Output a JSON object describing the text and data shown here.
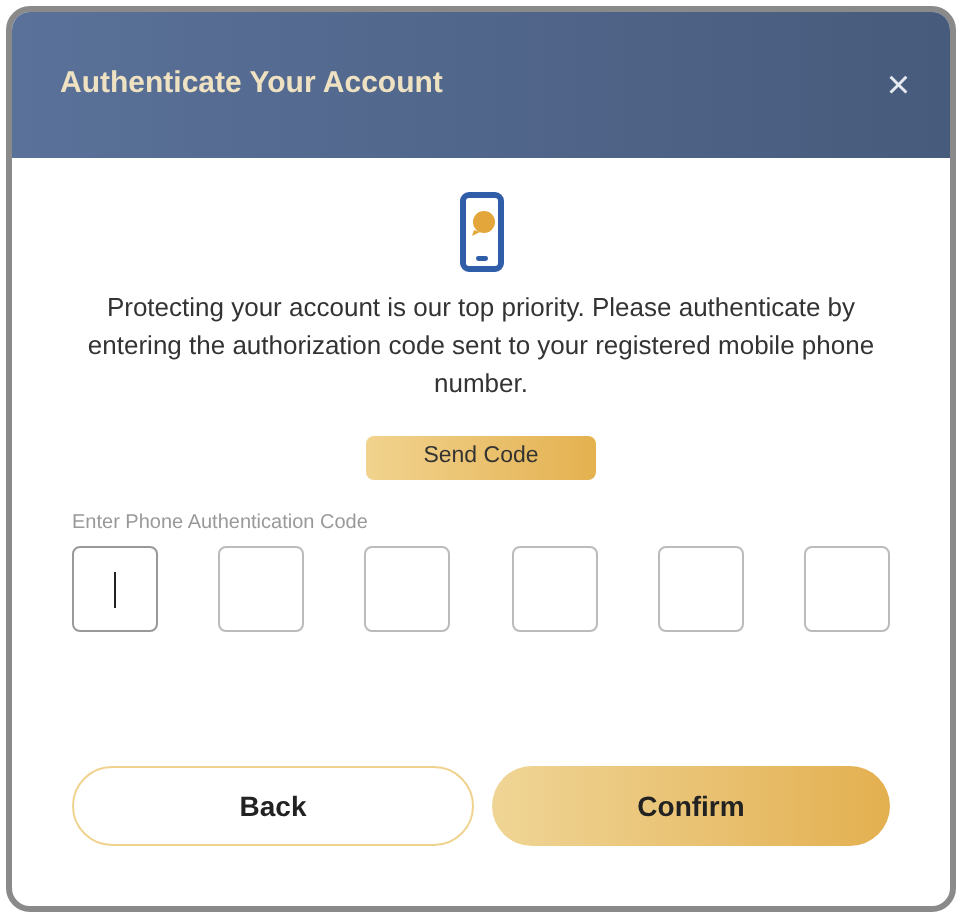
{
  "dialog": {
    "title": "Authenticate Your Account",
    "close": "×"
  },
  "message": "Protecting your account is our top priority. Please authenticate by entering the authorization code sent to your registered mobile phone number.",
  "send_button": "Send Code",
  "code_label": "Enter Phone Authentication Code",
  "code_boxes": [
    {
      "focused": true
    },
    {
      "focused": false
    },
    {
      "focused": false
    },
    {
      "focused": false
    },
    {
      "focused": false
    },
    {
      "focused": false
    }
  ],
  "buttons": [
    {
      "label": "Back",
      "kind": "secondary"
    },
    {
      "label": "Confirm",
      "kind": "primary"
    }
  ]
}
